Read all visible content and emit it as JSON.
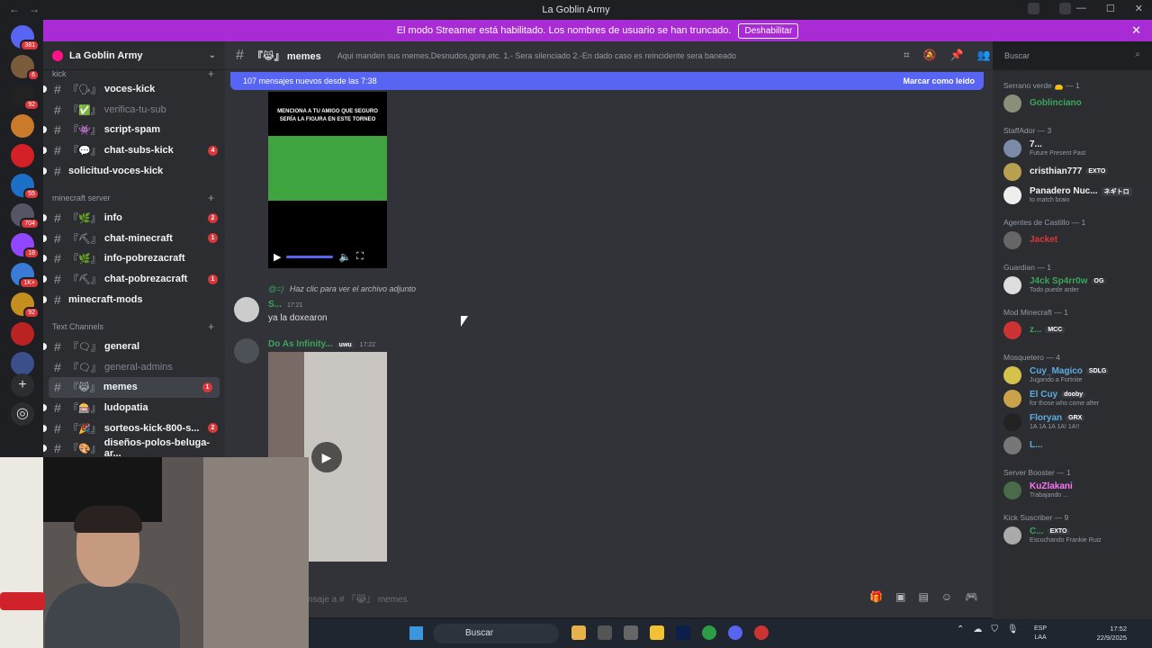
{
  "window": {
    "title": "La Goblin Army"
  },
  "banner": {
    "text": "El modo Streamer está habilitado. Los nombres de usuario se han truncado.",
    "button": "Deshabilitar"
  },
  "servers": [
    {
      "name": "discord-home",
      "badge": "381",
      "color": "#5865f2"
    },
    {
      "name": "server-2",
      "badge": "6",
      "color": "#7a5c3c"
    },
    {
      "name": "server-3",
      "badge": "92",
      "color": "#222"
    },
    {
      "name": "server-4",
      "badge": "",
      "color": "#c97a2a"
    },
    {
      "name": "server-5",
      "badge": "",
      "color": "#d42027"
    },
    {
      "name": "server-6",
      "badge": "55",
      "color": "#1d6fc8"
    },
    {
      "name": "server-7",
      "badge": "704",
      "color": "#556"
    },
    {
      "name": "server-8",
      "badge": "18",
      "color": "#9146ff"
    },
    {
      "name": "server-9",
      "badge": "1K+",
      "color": "#3a7bd5"
    },
    {
      "name": "server-10",
      "badge": "92",
      "color": "#c48f1f"
    },
    {
      "name": "server-11",
      "badge": "",
      "color": "#b22"
    },
    {
      "name": "server-12",
      "badge": "",
      "color": "#3b4f8a"
    }
  ],
  "sidebar": {
    "server_name": "La Goblin Army",
    "categories": [
      {
        "label": "kick",
        "y": 0
      },
      {
        "label": "minecraft server",
        "y": 1
      },
      {
        "label": "Text Channels",
        "y": 2
      }
    ],
    "channels_kick": [
      {
        "emo": "『🗣』",
        "label": "voces-kick",
        "state": "unread",
        "count": ""
      },
      {
        "emo": "『✅』",
        "label": "verifica-tu-sub",
        "state": "muted",
        "count": ""
      },
      {
        "emo": "『👾』",
        "label": "script-spam",
        "state": "unread",
        "count": ""
      },
      {
        "emo": "『💬』",
        "label": "chat-subs-kick",
        "state": "unread",
        "count": "4"
      },
      {
        "emo": "",
        "label": "solicitud-voces-kick",
        "state": "unread",
        "count": ""
      }
    ],
    "channels_mc": [
      {
        "emo": "『🌿』",
        "label": "info",
        "state": "unread",
        "count": "2"
      },
      {
        "emo": "『⛏』",
        "label": "chat-minecraft",
        "state": "unread",
        "count": "1"
      },
      {
        "emo": "『🌿』",
        "label": "info-pobrezacraft",
        "state": "unread",
        "count": ""
      },
      {
        "emo": "『⛏』",
        "label": "chat-pobrezacraft",
        "state": "unread",
        "count": "1"
      },
      {
        "emo": "",
        "label": "minecraft-mods",
        "state": "unread",
        "count": ""
      }
    ],
    "channels_text": [
      {
        "emo": "『🗨』",
        "label": "general",
        "state": "unread",
        "count": ""
      },
      {
        "emo": "『🗨』",
        "label": "general-admins",
        "state": "muted",
        "count": ""
      },
      {
        "emo": "『😹』",
        "label": "memes",
        "state": "selected",
        "count": "1"
      },
      {
        "emo": "『🎰』",
        "label": "ludopatia",
        "state": "unread",
        "count": ""
      },
      {
        "emo": "『🎉』",
        "label": "sorteos-kick-800-s...",
        "state": "unread",
        "count": "2"
      },
      {
        "emo": "『🎨』",
        "label": "diseños-polos-beluga-ar...",
        "state": "unread",
        "count": ""
      }
    ]
  },
  "chat": {
    "channel": "『😹』 memes",
    "topic": "Aqui manden sus memes.Desnudos,gore,etc. 1.- Sera silenciado 2.-En dado caso es reincidente sera baneado",
    "new_messages": "107 mensajes nuevos desde las 7:38",
    "mark_read": "Marcar como leído",
    "video_caption": "MENCIONA A TU AMIGO QUE SEGURO SERÍA LA FIGURA EN ESTE TORNEO",
    "reply_name": "@=)",
    "reply_text": "Haz clic para ver el archivo adjunto",
    "msg1_user": "S...",
    "msg1_time": "17:21",
    "msg1_text": "ya la doxearon",
    "msg2_user": "Do As Infinity...",
    "msg2_tag": "uwu",
    "msg2_time": "17:22",
    "composer_placeholder": "nsaje a # 『😹』 memes"
  },
  "search": {
    "placeholder": "Buscar"
  },
  "members": [
    {
      "kind": "role",
      "label": "Serrano verde 👝 — 1"
    },
    {
      "kind": "member",
      "name": "Goblinciano",
      "color": "#3ba55d",
      "tag": "",
      "status": "",
      "av": "#8a8f7a"
    },
    {
      "kind": "role",
      "label": "StaffAdor — 3"
    },
    {
      "kind": "member",
      "name": "7...",
      "color": "#f2f3f5",
      "tag": "",
      "status": "Future Present Past",
      "av": "#7b8aa6"
    },
    {
      "kind": "member",
      "name": "cristhian777",
      "color": "#f2f3f5",
      "tag": "EXTO",
      "status": "",
      "av": "#b8a050"
    },
    {
      "kind": "member",
      "name": "Panadero Nuc...",
      "color": "#f2f3f5",
      "tag": "ネギトロ",
      "status": "to match brain",
      "av": "#eee"
    },
    {
      "kind": "role",
      "label": "Agentes de Castillo — 1"
    },
    {
      "kind": "member",
      "name": "Jacket",
      "color": "#da373c",
      "tag": "",
      "status": "",
      "av": "#666"
    },
    {
      "kind": "role",
      "label": "Guardian — 1"
    },
    {
      "kind": "member",
      "name": "J4ck Sp4rr0w",
      "color": "#3ba55d",
      "tag": "OG",
      "status": "Todo puede arder",
      "av": "#ddd"
    },
    {
      "kind": "role",
      "label": "Mod Minecraft — 1"
    },
    {
      "kind": "member",
      "name": "z...",
      "color": "#3ba55d",
      "tag": "MCC",
      "status": "",
      "av": "#c33"
    },
    {
      "kind": "role",
      "label": "Mosquetero — 4"
    },
    {
      "kind": "member",
      "name": "Cuy_Magico",
      "color": "#5dade2",
      "tag": "SDLG",
      "status": "Jugando a Fortnite",
      "av": "#d4c24a"
    },
    {
      "kind": "member",
      "name": "El Cuy",
      "color": "#5dade2",
      "tag": "dooby",
      "status": "for those who come after",
      "av": "#c9a24a"
    },
    {
      "kind": "member",
      "name": "Floryan",
      "color": "#5dade2",
      "tag": "GRX",
      "status": "1A 1A 1A 1A! 1A!!",
      "av": "#222"
    },
    {
      "kind": "member",
      "name": "L...",
      "color": "#5dade2",
      "tag": "",
      "status": "",
      "av": "#777"
    },
    {
      "kind": "role",
      "label": "Server Booster — 1"
    },
    {
      "kind": "member",
      "name": "KuZlakani",
      "color": "#ff73fa",
      "tag": "",
      "status": "Trabajando ...",
      "av": "#4a6b4a"
    },
    {
      "kind": "role",
      "label": "Kick Suscriber — 9"
    },
    {
      "kind": "member",
      "name": "C...",
      "color": "#3ba55d",
      "tag": "EXTO",
      "status": "Escuchando Frankie Ruiz",
      "av": "#aaa"
    }
  ],
  "taskbar": {
    "search": "Buscar",
    "lang1": "ESP",
    "lang2": "LAA",
    "time": "17:52",
    "date": "22/9/2025"
  }
}
